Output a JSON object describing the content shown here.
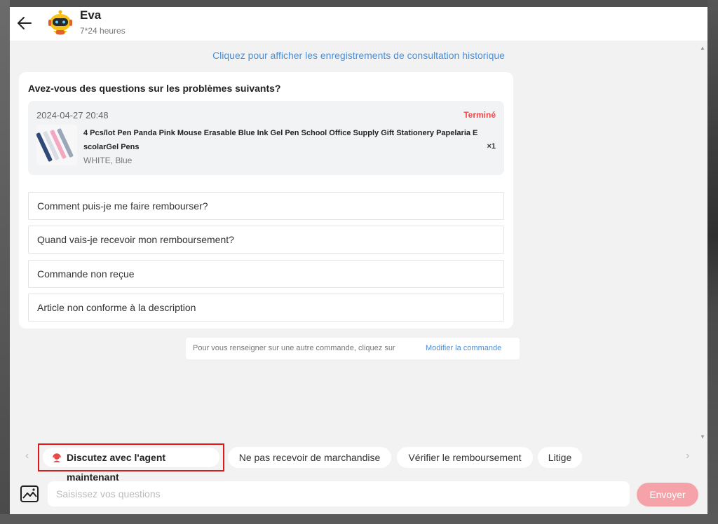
{
  "header": {
    "contact_name": "Eva",
    "contact_availability": "7*24 heures"
  },
  "history_link": "Cliquez pour afficher les enregistrements de consultation historique",
  "card": {
    "title": "Avez-vous des questions sur les problèmes suivants?",
    "order": {
      "date": "2024-04-27 20:48",
      "status": "Terminé",
      "product_title": "4 Pcs/lot Pen Panda Pink Mouse Erasable Blue Ink Gel Pen School Office Supply Gift Stationery Papelaria EscolarGel Pens",
      "variant": "WHITE, Blue",
      "quantity": "×1"
    },
    "questions": [
      "Comment puis-je me faire rembourser?",
      "Quand vais-je recevoir mon remboursement?",
      "Commande non reçue",
      "Article non conforme à la description"
    ]
  },
  "other_order": {
    "text": "Pour vous renseigner sur une autre commande, cliquez sur",
    "link": "Modifier la commande"
  },
  "quick_replies": {
    "agent": "Discutez avec l'agent maintenant",
    "items": [
      "Ne pas recevoir de marchandise",
      "Vérifier le remboursement",
      "Litige"
    ]
  },
  "composer": {
    "placeholder": "Saisissez vos questions",
    "send_label": "Envoyer"
  },
  "colors": {
    "link": "#4a90d9",
    "status": "#e84a4a",
    "send_button": "#f5a3a8",
    "highlight_border": "#e01a1a"
  }
}
